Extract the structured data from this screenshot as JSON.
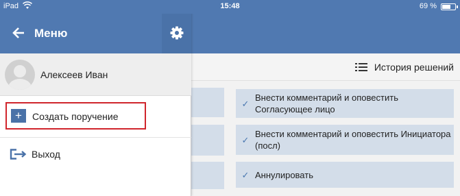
{
  "status_bar": {
    "carrier": "iPad",
    "time": "15:48",
    "battery_percent_text": "69 %",
    "battery_level": 0.69
  },
  "drawer": {
    "title": "Меню",
    "profile_name": "Алексеев Иван",
    "items": [
      {
        "label": "Создать поручение",
        "icon": "plus-icon"
      },
      {
        "label": "Выход",
        "icon": "exit-icon"
      }
    ]
  },
  "main": {
    "history_label": "История решений",
    "actions": [
      {
        "label": "Внести комментарий и оповестить Согласующее лицо"
      },
      {
        "label": "Внести комментарий и оповестить Инициатора (посл)"
      },
      {
        "label": "Аннулировать"
      }
    ]
  },
  "colors": {
    "header_blue": "#5079b1",
    "gear_block": "#4a72a8",
    "card_bg": "#d3dde9",
    "highlight_red": "#d0242b"
  }
}
